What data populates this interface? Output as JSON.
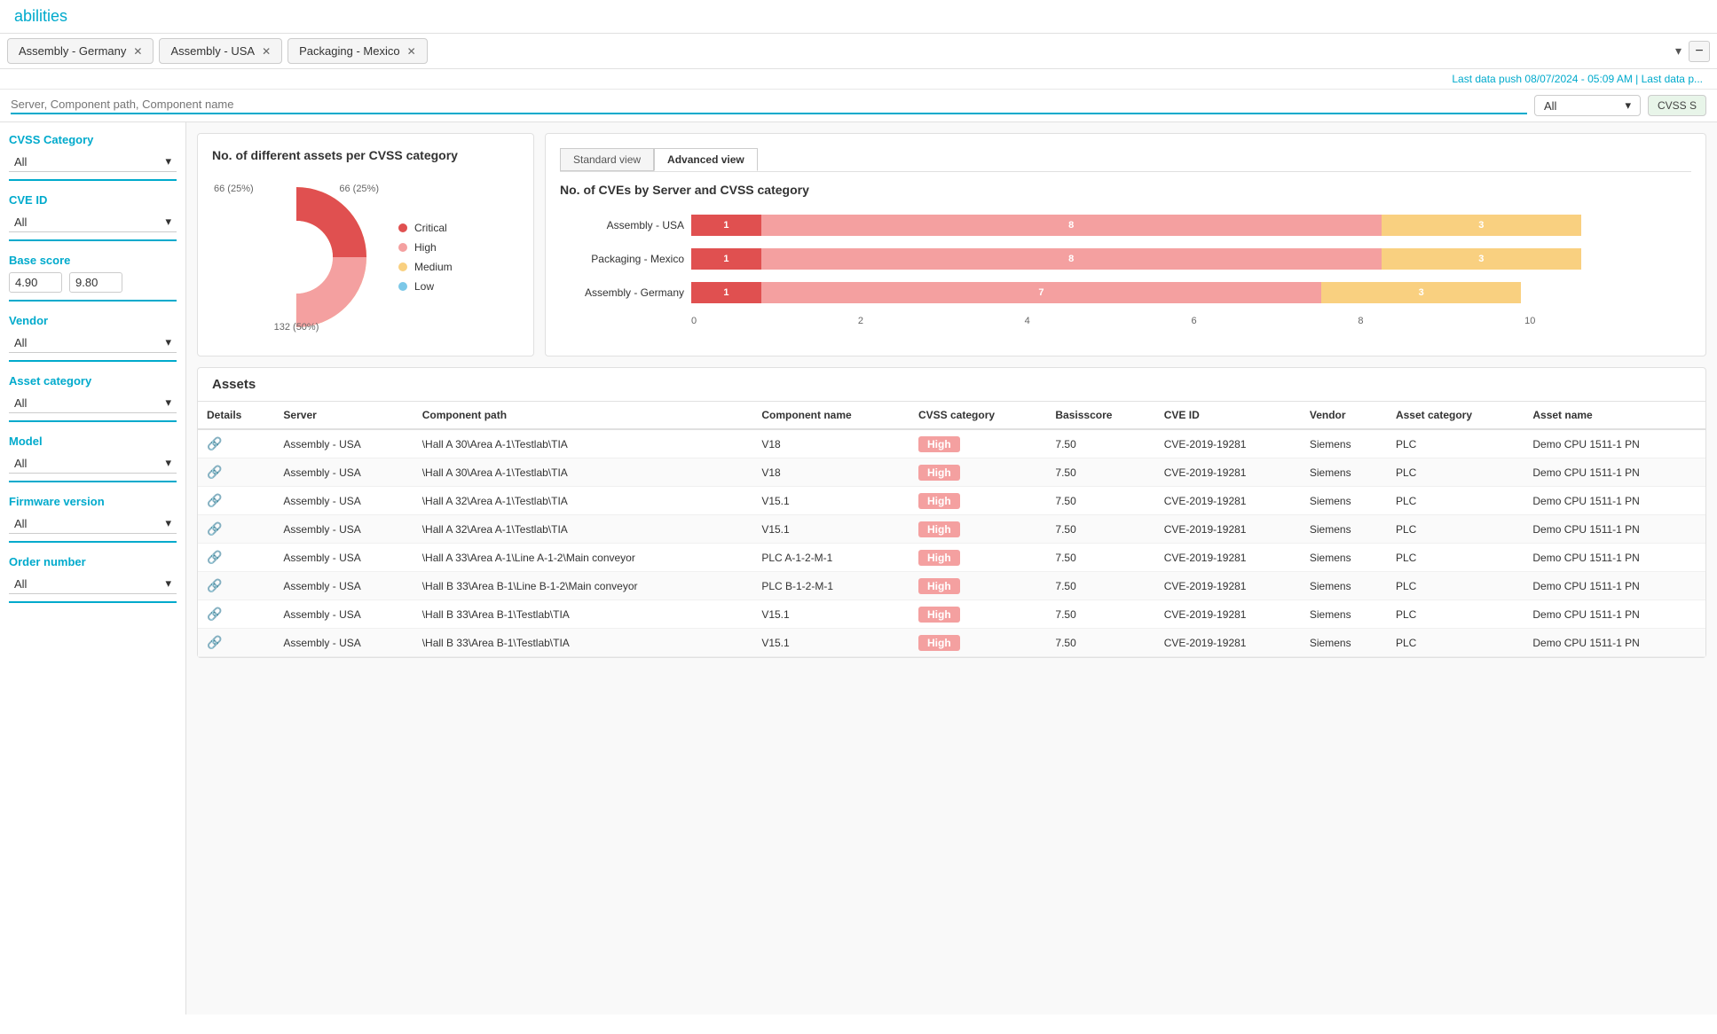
{
  "header": {
    "title": "abilities"
  },
  "tabs": [
    {
      "label": "Assembly - Germany",
      "id": "tab-germany"
    },
    {
      "label": "Assembly - USA",
      "id": "tab-usa"
    },
    {
      "label": "Packaging - Mexico",
      "id": "tab-mexico"
    }
  ],
  "status": {
    "text": "Last data push 08/07/2024 - 05:09 AM | Last data p..."
  },
  "search": {
    "placeholder": "Server, Component path, Component name",
    "cvss_label": "CVSS S",
    "filter_all": "All"
  },
  "filters": [
    {
      "id": "cvss-category",
      "label": "CVSS Category",
      "value": "All"
    },
    {
      "id": "cve-id",
      "label": "CVE ID",
      "value": "All"
    },
    {
      "id": "base-score",
      "label": "Base score",
      "min": "4.90",
      "max": "9.80"
    },
    {
      "id": "vendor",
      "label": "Vendor",
      "value": "All"
    },
    {
      "id": "asset-category",
      "label": "Asset category",
      "value": "All"
    },
    {
      "id": "model",
      "label": "Model",
      "value": "All"
    },
    {
      "id": "firmware-version",
      "label": "Firmware version",
      "value": "All"
    },
    {
      "id": "order-number",
      "label": "Order number",
      "value": "All"
    }
  ],
  "donut_chart": {
    "title": "No. of different assets per CVSS category",
    "segments": [
      {
        "label": "Critical",
        "color": "#e05050",
        "percent": 25,
        "count": 66
      },
      {
        "label": "High",
        "color": "#f4a0a0",
        "percent": 25,
        "count": 66
      },
      {
        "label": "Medium",
        "color": "#f9d080",
        "percent": 50,
        "count": 132
      },
      {
        "label": "Low",
        "color": "#7cc8e8",
        "percent": 0,
        "count": 0
      }
    ],
    "labels": {
      "top_left": "66 (25%)",
      "top_right": "66 (25%)",
      "bottom": "132 (50%)"
    }
  },
  "bar_chart": {
    "title": "No. of CVEs by Server and CVSS category",
    "view_tabs": [
      "Standard view",
      "Advanced view"
    ],
    "active_tab": "Advanced view",
    "rows": [
      {
        "server": "Assembly - USA",
        "critical": 1,
        "high": 8,
        "medium": 3
      },
      {
        "server": "Packaging - Mexico",
        "critical": 1,
        "high": 8,
        "medium": 3
      },
      {
        "server": "Assembly - Germany",
        "critical": 1,
        "high": 7,
        "medium": 3
      }
    ],
    "x_axis": [
      "0",
      "2",
      "4",
      "6",
      "8",
      "10"
    ]
  },
  "assets_table": {
    "title": "Assets",
    "columns": [
      "Details",
      "Server",
      "Component path",
      "Component name",
      "CVSS category",
      "Basisscore",
      "CVE ID",
      "Vendor",
      "Asset category",
      "Asset name"
    ],
    "rows": [
      {
        "server": "Assembly - USA",
        "path": "\\Hall A 30\\Area A-1\\Testlab\\TIA",
        "component": "V18",
        "cvss": "High",
        "score": "7.50",
        "cve": "CVE-2019-19281",
        "vendor": "Siemens",
        "category": "PLC",
        "asset": "Demo CPU 1511-1 PN"
      },
      {
        "server": "Assembly - USA",
        "path": "\\Hall A 30\\Area A-1\\Testlab\\TIA",
        "component": "V18",
        "cvss": "High",
        "score": "7.50",
        "cve": "CVE-2019-19281",
        "vendor": "Siemens",
        "category": "PLC",
        "asset": "Demo CPU 1511-1 PN"
      },
      {
        "server": "Assembly - USA",
        "path": "\\Hall A 32\\Area A-1\\Testlab\\TIA",
        "component": "V15.1",
        "cvss": "High",
        "score": "7.50",
        "cve": "CVE-2019-19281",
        "vendor": "Siemens",
        "category": "PLC",
        "asset": "Demo CPU 1511-1 PN"
      },
      {
        "server": "Assembly - USA",
        "path": "\\Hall A 32\\Area A-1\\Testlab\\TIA",
        "component": "V15.1",
        "cvss": "High",
        "score": "7.50",
        "cve": "CVE-2019-19281",
        "vendor": "Siemens",
        "category": "PLC",
        "asset": "Demo CPU 1511-1 PN"
      },
      {
        "server": "Assembly - USA",
        "path": "\\Hall A 33\\Area A-1\\Line A-1-2\\Main conveyor",
        "component": "PLC A-1-2-M-1",
        "cvss": "High",
        "score": "7.50",
        "cve": "CVE-2019-19281",
        "vendor": "Siemens",
        "category": "PLC",
        "asset": "Demo CPU 1511-1 PN"
      },
      {
        "server": "Assembly - USA",
        "path": "\\Hall B 33\\Area B-1\\Line B-1-2\\Main conveyor",
        "component": "PLC B-1-2-M-1",
        "cvss": "High",
        "score": "7.50",
        "cve": "CVE-2019-19281",
        "vendor": "Siemens",
        "category": "PLC",
        "asset": "Demo CPU 1511-1 PN"
      },
      {
        "server": "Assembly - USA",
        "path": "\\Hall B 33\\Area B-1\\Testlab\\TIA",
        "component": "V15.1",
        "cvss": "High",
        "score": "7.50",
        "cve": "CVE-2019-19281",
        "vendor": "Siemens",
        "category": "PLC",
        "asset": "Demo CPU 1511-1 PN"
      },
      {
        "server": "Assembly - USA",
        "path": "\\Hall B 33\\Area B-1\\Testlab\\TIA",
        "component": "V15.1",
        "cvss": "High",
        "score": "7.50",
        "cve": "CVE-2019-19281",
        "vendor": "Siemens",
        "category": "PLC",
        "asset": "Demo CPU 1511-1 PN"
      }
    ]
  }
}
